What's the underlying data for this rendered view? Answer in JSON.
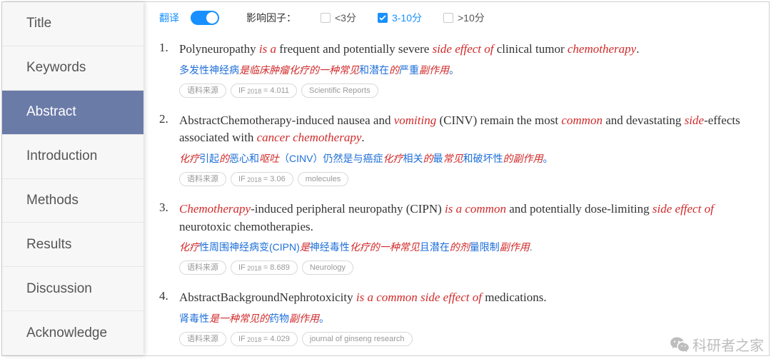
{
  "sidebar": {
    "items": [
      {
        "label": "Title"
      },
      {
        "label": "Keywords"
      },
      {
        "label": "Abstract"
      },
      {
        "label": "Introduction"
      },
      {
        "label": "Methods"
      },
      {
        "label": "Results"
      },
      {
        "label": "Discussion"
      },
      {
        "label": "Acknowledge"
      }
    ],
    "active_index": 2
  },
  "filters": {
    "translate_label": "翻译",
    "factor_label": "影响因子：",
    "options": [
      {
        "label": "<3分",
        "checked": false
      },
      {
        "label": "3-10分",
        "checked": true
      },
      {
        "label": ">10分",
        "checked": false
      }
    ]
  },
  "results": [
    {
      "en": [
        [
          "Polyneuropathy ",
          0
        ],
        [
          "is a",
          1
        ],
        [
          " frequent and potentially severe ",
          0
        ],
        [
          "side effect of",
          1
        ],
        [
          " clinical tumor ",
          0
        ],
        [
          "chemotherapy",
          1
        ],
        [
          ".",
          0
        ]
      ],
      "zh": [
        [
          "多发性神经病",
          0
        ],
        [
          "是临床肿瘤化疗的一种常见",
          1
        ],
        [
          "和潜在",
          0
        ],
        [
          "的",
          1
        ],
        [
          "严重",
          0
        ],
        [
          "副作用",
          1
        ],
        [
          "。",
          0
        ]
      ],
      "tags": {
        "source": "语料来源",
        "if": "IF 2018 = 4.011",
        "journal": "Scientific Reports"
      }
    },
    {
      "en": [
        [
          "AbstractChemotherapy-induced nausea and ",
          0
        ],
        [
          "vomiting",
          1
        ],
        [
          " (CINV) remain the most ",
          0
        ],
        [
          "common",
          1
        ],
        [
          " and devastating ",
          0
        ],
        [
          "side",
          1
        ],
        [
          "-effects associated with ",
          0
        ],
        [
          "cancer chemotherapy",
          1
        ],
        [
          ".",
          0
        ]
      ],
      "zh": [
        [
          "化疗",
          1
        ],
        [
          "引起",
          0
        ],
        [
          "的",
          1
        ],
        [
          "恶心和",
          0
        ],
        [
          "呕吐",
          1
        ],
        [
          "（CINV）仍然是与癌症",
          0
        ],
        [
          "化疗",
          1
        ],
        [
          "相关",
          0
        ],
        [
          "的",
          1
        ],
        [
          "最",
          0
        ],
        [
          "常见",
          1
        ],
        [
          "和破坏性",
          0
        ],
        [
          "的副作用",
          1
        ],
        [
          "。",
          0
        ]
      ],
      "tags": {
        "source": "语料来源",
        "if": "IF 2018 = 3.06",
        "journal": "molecules"
      }
    },
    {
      "en": [
        [
          "Chemotherapy",
          1
        ],
        [
          "-induced peripheral neuropathy (CIPN) ",
          0
        ],
        [
          "is a common",
          1
        ],
        [
          " and potentially dose-limiting ",
          0
        ],
        [
          "side effect of",
          1
        ],
        [
          " neurotoxic chemotherapies.",
          0
        ]
      ],
      "zh": [
        [
          "化疗",
          1
        ],
        [
          "性周围神经病变(CIPN)",
          0
        ],
        [
          "是",
          1
        ],
        [
          "神经毒性",
          0
        ],
        [
          "化疗的一种常见",
          1
        ],
        [
          "且潜在",
          0
        ],
        [
          "的剂",
          1
        ],
        [
          "量限制",
          0
        ],
        [
          "副作用",
          1
        ],
        [
          ".",
          0
        ]
      ],
      "tags": {
        "source": "语料来源",
        "if": "IF 2018 = 8.689",
        "journal": "Neurology"
      }
    },
    {
      "en": [
        [
          "AbstractBackgroundNephrotoxicity ",
          0
        ],
        [
          "is a common side effect of",
          1
        ],
        [
          " medications.",
          0
        ]
      ],
      "zh": [
        [
          "肾毒性",
          0
        ],
        [
          "是一种常见的",
          1
        ],
        [
          "药物",
          0
        ],
        [
          "副作用",
          1
        ],
        [
          "。",
          0
        ]
      ],
      "tags": {
        "source": "语料来源",
        "if": "IF 2018 = 4.029",
        "journal": "journal of ginseng research"
      }
    }
  ],
  "watermark": "科研者之家"
}
